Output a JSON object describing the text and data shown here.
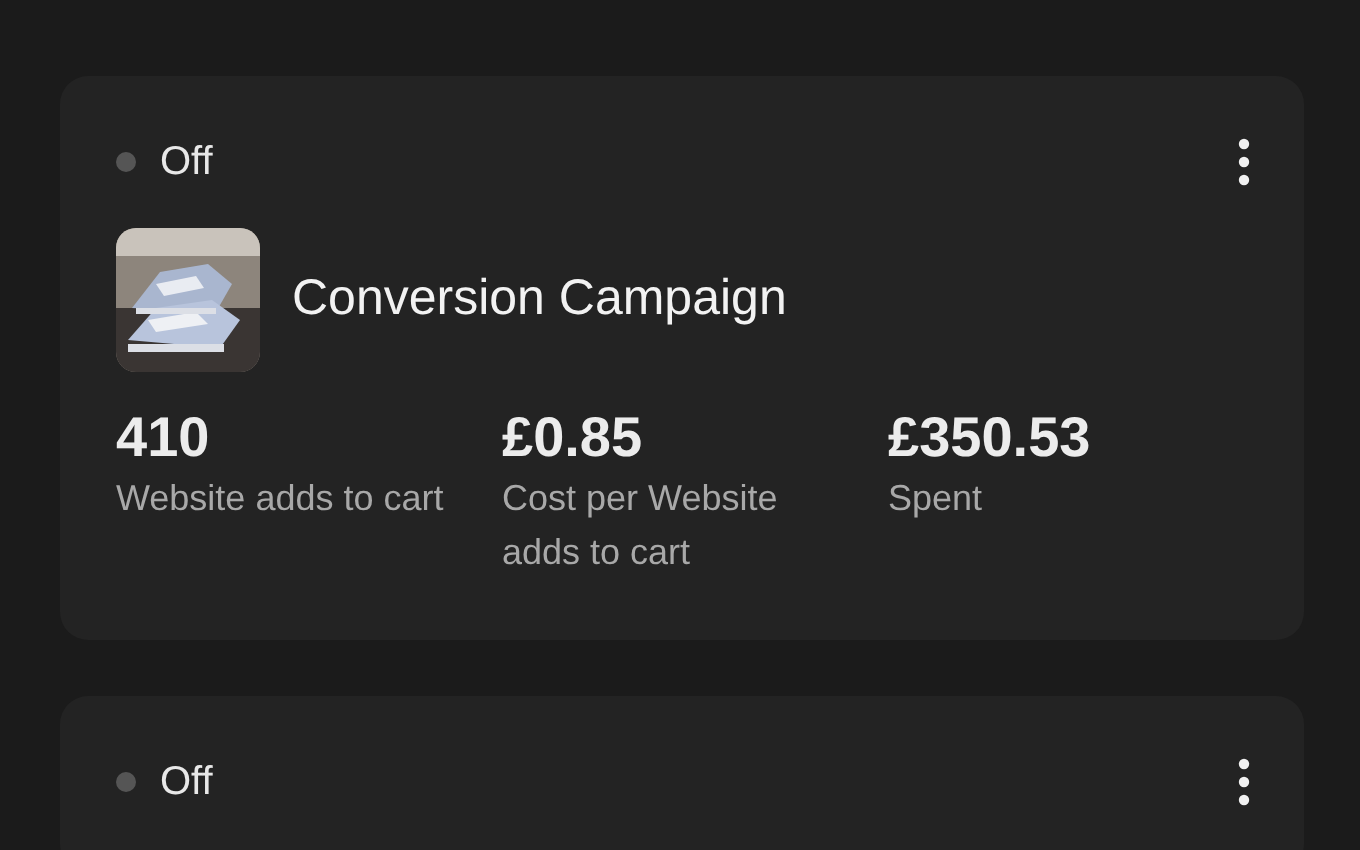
{
  "campaigns": [
    {
      "status": {
        "label": "Off",
        "on": false
      },
      "name": "Conversion Campaign",
      "metrics": [
        {
          "value": "410",
          "label": "Website adds to cart"
        },
        {
          "value": "£0.85",
          "label": "Cost per Website adds to cart"
        },
        {
          "value": "£350.53",
          "label": "Spent"
        }
      ]
    },
    {
      "status": {
        "label": "Off",
        "on": false
      }
    }
  ]
}
